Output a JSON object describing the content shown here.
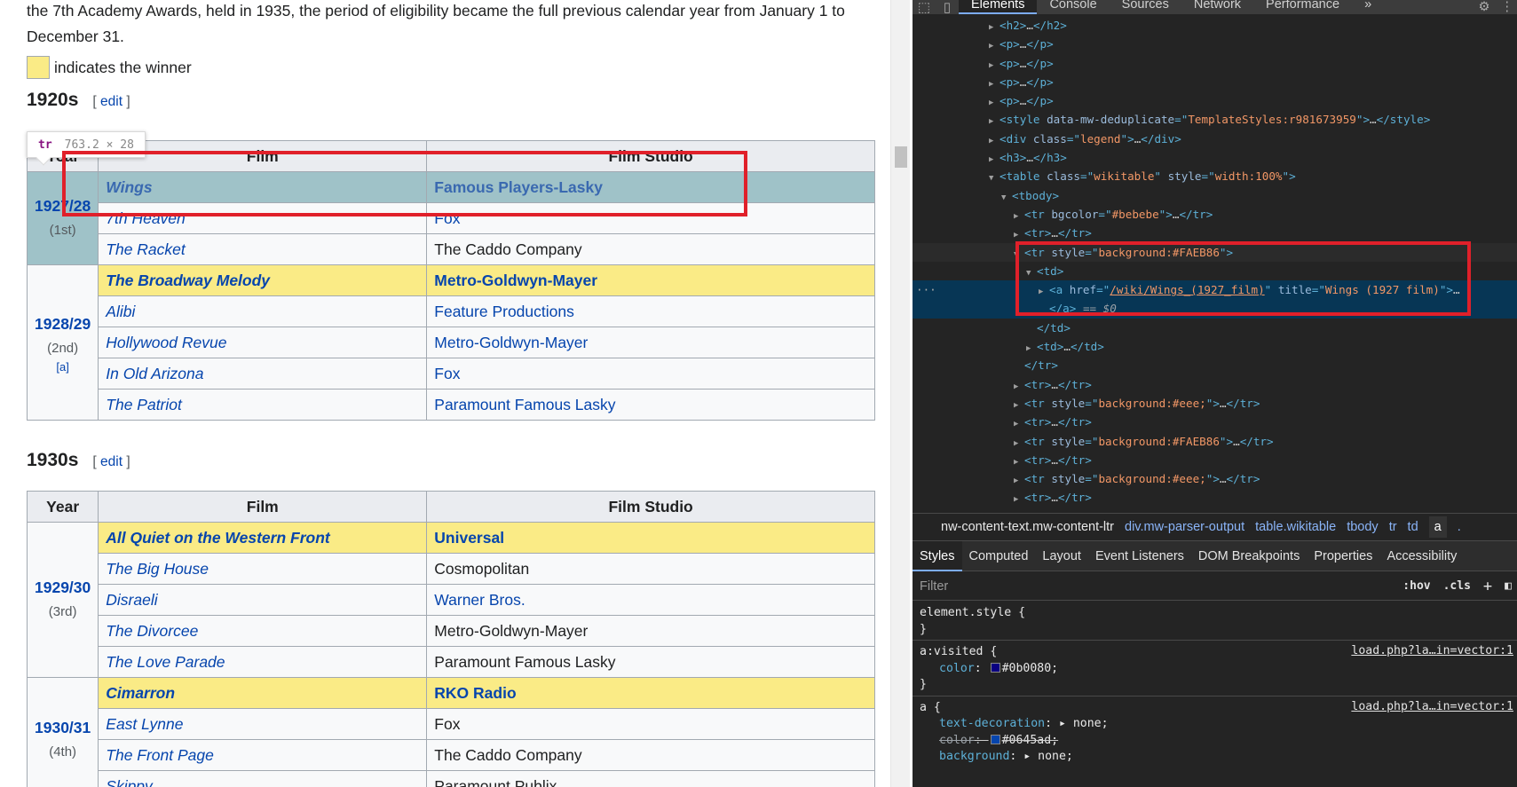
{
  "wiki": {
    "intro": "the 7th Academy Awards, held in 1935, the period of eligibility became the full previous calendar year from January 1 to December 31.",
    "legend_text": "indicates the winner",
    "edit_label": "edit",
    "decades": [
      {
        "title": "1920s",
        "headers": [
          "Year",
          "Film",
          "Film Studio"
        ],
        "years": [
          {
            "year": "1927/28",
            "ordinal": "(1st)",
            "note": "",
            "films": [
              {
                "film": "Wings",
                "studio": "Famous Players-Lasky",
                "winner": true
              },
              {
                "film": "7th Heaven",
                "studio": "Fox",
                "winner": false
              },
              {
                "film": "The Racket",
                "studio": "The Caddo Company",
                "winner": false
              }
            ]
          },
          {
            "year": "1928/29",
            "ordinal": "(2nd)",
            "note": "[a]",
            "films": [
              {
                "film": "The Broadway Melody",
                "studio": "Metro-Goldwyn-Mayer",
                "winner": true
              },
              {
                "film": "Alibi",
                "studio": "Feature Productions",
                "winner": false
              },
              {
                "film": "Hollywood Revue",
                "studio": "Metro-Goldwyn-Mayer",
                "winner": false
              },
              {
                "film": "In Old Arizona",
                "studio": "Fox",
                "winner": false
              },
              {
                "film": "The Patriot",
                "studio": "Paramount Famous Lasky",
                "winner": false
              }
            ]
          }
        ]
      },
      {
        "title": "1930s",
        "headers": [
          "Year",
          "Film",
          "Film Studio"
        ],
        "years": [
          {
            "year": "1929/30",
            "ordinal": "(3rd)",
            "note": "",
            "films": [
              {
                "film": "All Quiet on the Western Front",
                "studio": "Universal",
                "winner": true
              },
              {
                "film": "The Big House",
                "studio": "Cosmopolitan",
                "winner": false
              },
              {
                "film": "Disraeli",
                "studio": "Warner Bros.",
                "winner": false
              },
              {
                "film": "The Divorcee",
                "studio": "Metro-Goldwyn-Mayer",
                "winner": false
              },
              {
                "film": "The Love Parade",
                "studio": "Paramount Famous Lasky",
                "winner": false
              }
            ]
          },
          {
            "year": "1930/31",
            "ordinal": "(4th)",
            "note": "",
            "films": [
              {
                "film": "Cimarron",
                "studio": "RKO Radio",
                "winner": true
              },
              {
                "film": "East Lynne",
                "studio": "Fox",
                "winner": false
              },
              {
                "film": "The Front Page",
                "studio": "The Caddo Company",
                "winner": false
              },
              {
                "film": "Skippy",
                "studio": "Paramount Publix",
                "winner": false
              }
            ]
          }
        ]
      }
    ],
    "tooltip": {
      "tag": "tr",
      "size": "763.2 × 28"
    },
    "colors": {
      "winner": "#FAEB86",
      "highlight": "#9fc2c8",
      "link": "#0645ad",
      "annotation": "#e0202a"
    }
  },
  "devtools": {
    "tabs": [
      "Elements",
      "Console",
      "Sources",
      "Network",
      "Performance"
    ],
    "active_tab": "Elements",
    "more_tabs": "»",
    "tree_attr_style": "background:#FAEB86",
    "tree_attr_href": "/wiki/Wings_(1927_film)",
    "tree_attr_title": "Wings (1927 film)",
    "tree_attr_table_class": "wikitable",
    "tree_attr_table_style": "width:100%",
    "tree_attr_bgcolor": "#bebebe",
    "tree_attr_eee": "background:#eee;",
    "tree_attr_legend": "legend",
    "tree_attr_dedupe": "TemplateStyles:r981673959",
    "tree_dollar": "== $0",
    "breadcrumbs": [
      "nw-content-text.mw-content-ltr",
      "div.mw-parser-output",
      "table.wikitable",
      "tbody",
      "tr",
      "td",
      "a",
      "."
    ],
    "sub_tabs": [
      "Styles",
      "Computed",
      "Layout",
      "Event Listeners",
      "DOM Breakpoints",
      "Properties",
      "Accessibility"
    ],
    "active_sub_tab": "Styles",
    "filter_placeholder": "Filter",
    "filter_hov": ":hov",
    "filter_cls": ".cls",
    "styles": {
      "element_style": "element.style {",
      "visited_selector": "a:visited {",
      "visited_prop": "color",
      "visited_val": "#0b0080;",
      "visited_src": "load.php?la…in=vector:1",
      "a_selector": "a {",
      "a_src": "load.php?la…in=vector:1",
      "a_props": [
        {
          "prop": "text-decoration",
          "val": "none;",
          "struck": false
        },
        {
          "prop": "color",
          "val": "#0645ad;",
          "struck": true
        },
        {
          "prop": "background",
          "val": "none;",
          "struck": false
        }
      ],
      "close": "}"
    }
  }
}
